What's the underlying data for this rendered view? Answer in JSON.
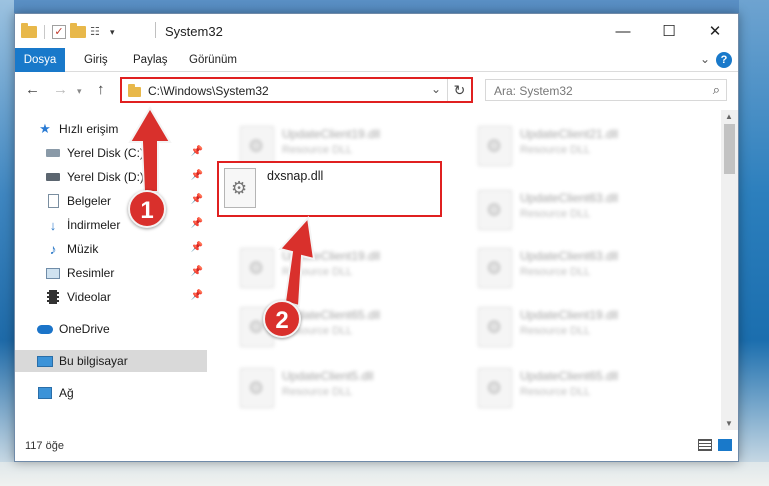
{
  "window": {
    "title": "System32",
    "minimize_icon": "minimize-icon",
    "maximize_icon": "maximize-icon",
    "close_icon": "close-icon"
  },
  "ribbon": {
    "tabs": [
      "Dosya",
      "Giriş",
      "Paylaş",
      "Görünüm"
    ],
    "help_label": "?"
  },
  "address": {
    "path": "C:\\Windows\\System32",
    "search_placeholder": "Ara: System32"
  },
  "nav_pane": {
    "items": [
      {
        "label": "Hızlı erişim",
        "icon": "star-icon"
      },
      {
        "label": "Yerel Disk (C:)",
        "icon": "disk-icon"
      },
      {
        "label": "Yerel Disk (D:)",
        "icon": "disk-icon"
      },
      {
        "label": "Belgeler",
        "icon": "document-icon"
      },
      {
        "label": "İndirmeler",
        "icon": "download-icon"
      },
      {
        "label": "Müzik",
        "icon": "music-icon"
      },
      {
        "label": "Resimler",
        "icon": "pictures-icon"
      },
      {
        "label": "Videolar",
        "icon": "videos-icon"
      },
      {
        "label": "OneDrive",
        "icon": "cloud-icon"
      },
      {
        "label": "Bu bilgisayar",
        "icon": "computer-icon"
      },
      {
        "label": "Ağ",
        "icon": "network-icon"
      }
    ]
  },
  "files": [
    {
      "name": "UpdateClient19.dll",
      "type": "Resource DLL"
    },
    {
      "name": "UpdateClient21.dll",
      "type": "Resource DLL"
    },
    {
      "name": "UpdateClient63.dll",
      "type": "Resource DLL"
    },
    {
      "name": "UpdateClient19.dll",
      "type": "Resource DLL"
    },
    {
      "name": "UpdateClient63.dll",
      "type": "Resource DLL"
    },
    {
      "name": "UpdateClient65.dll",
      "type": "Resource DLL"
    },
    {
      "name": "UpdateClient19.dll",
      "type": "Resource DLL"
    },
    {
      "name": "UpdateClient5.dll",
      "type": "Resource DLL"
    },
    {
      "name": "UpdateClient65.dll",
      "type": "Resource DLL"
    }
  ],
  "highlighted_file": {
    "name": "dxsnap.dll"
  },
  "status": {
    "item_count": "117 öğe"
  },
  "annotations": {
    "callout_1": "1",
    "callout_2": "2"
  },
  "colors": {
    "accent": "#1979ca",
    "highlight": "#e02020",
    "callout": "#d9302c"
  }
}
